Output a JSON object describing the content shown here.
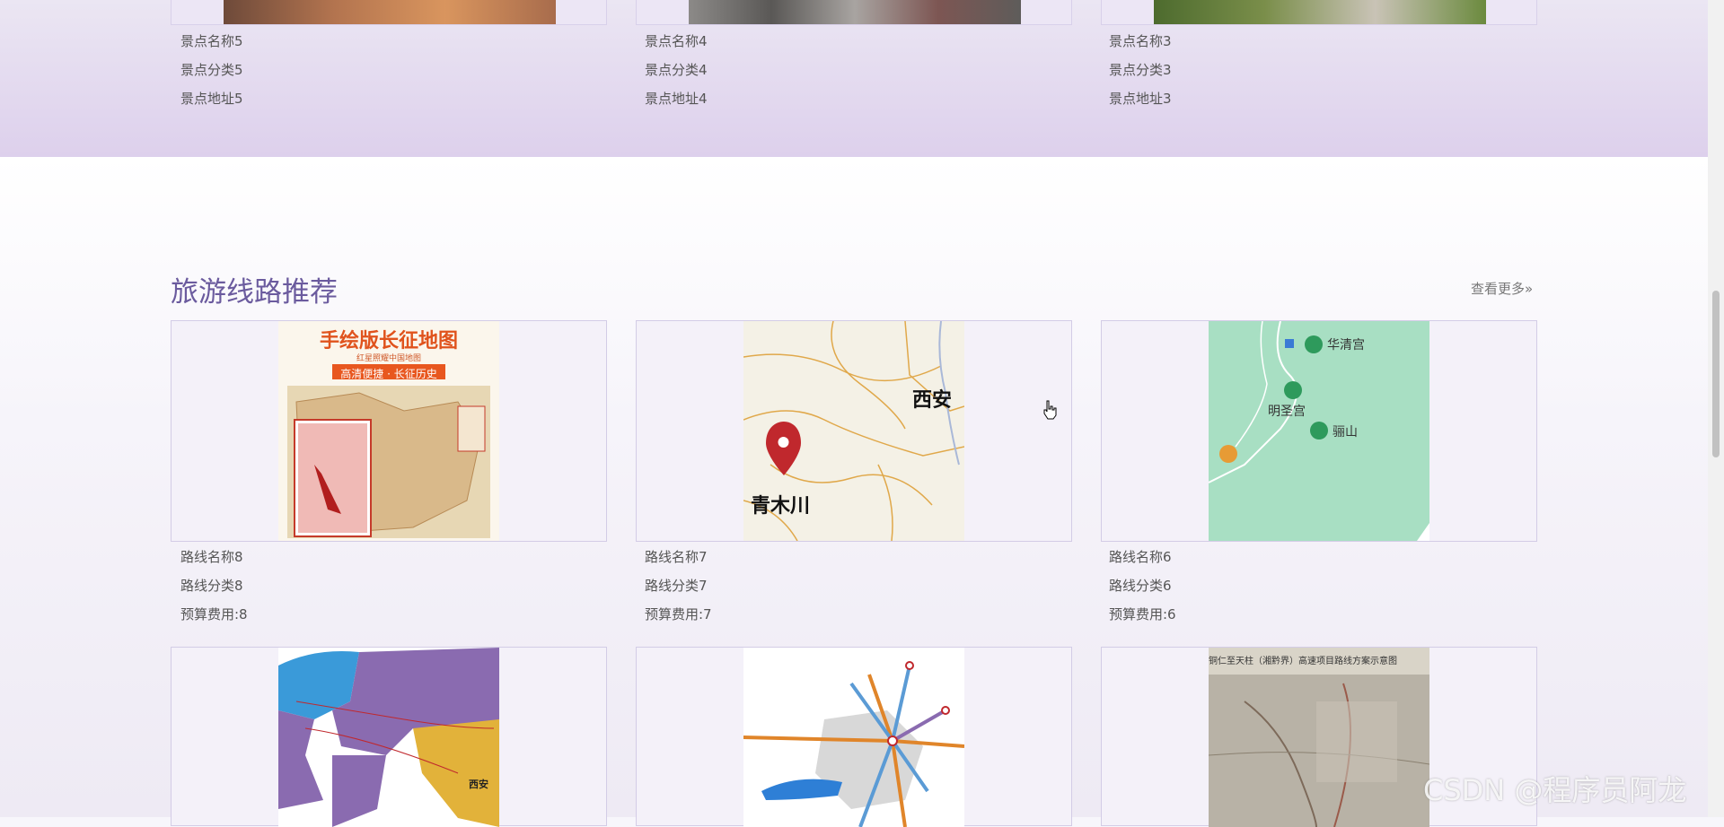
{
  "attractions": {
    "items": [
      {
        "name": "景点名称5",
        "category": "景点分类5",
        "address": "景点地址5"
      },
      {
        "name": "景点名称4",
        "category": "景点分类4",
        "address": "景点地址4"
      },
      {
        "name": "景点名称3",
        "category": "景点分类3",
        "address": "景点地址3"
      }
    ]
  },
  "routes": {
    "title": "旅游线路推荐",
    "more_label": "查看更多»",
    "items": [
      {
        "name": "路线名称8",
        "category": "路线分类8",
        "budget": "预算费用:8",
        "map_title": "手绘版长征地图",
        "map_subtitle": "红星照耀中国地图",
        "map_banner": "高清便捷 · 长征历史"
      },
      {
        "name": "路线名称7",
        "category": "路线分类7",
        "budget": "预算费用:7",
        "map_city1": "西安",
        "map_city2": "青木川"
      },
      {
        "name": "路线名称6",
        "category": "路线分类6",
        "budget": "预算费用:6",
        "map_label1": "华清宫",
        "map_label2": "明圣宫",
        "map_label3": "骊山"
      }
    ],
    "bottom_row": [
      {
        "image": "eurasia-map",
        "map_label": "西安"
      },
      {
        "image": "railway-map"
      },
      {
        "image": "highway-plan-map",
        "map_title": "铜仁至天柱（湘黔界）高速项目路线方案示意图"
      }
    ]
  },
  "watermark": "CSDN @程序员阿龙",
  "colors": {
    "accent": "#6b5b9e",
    "band": "#ddd0ec"
  }
}
